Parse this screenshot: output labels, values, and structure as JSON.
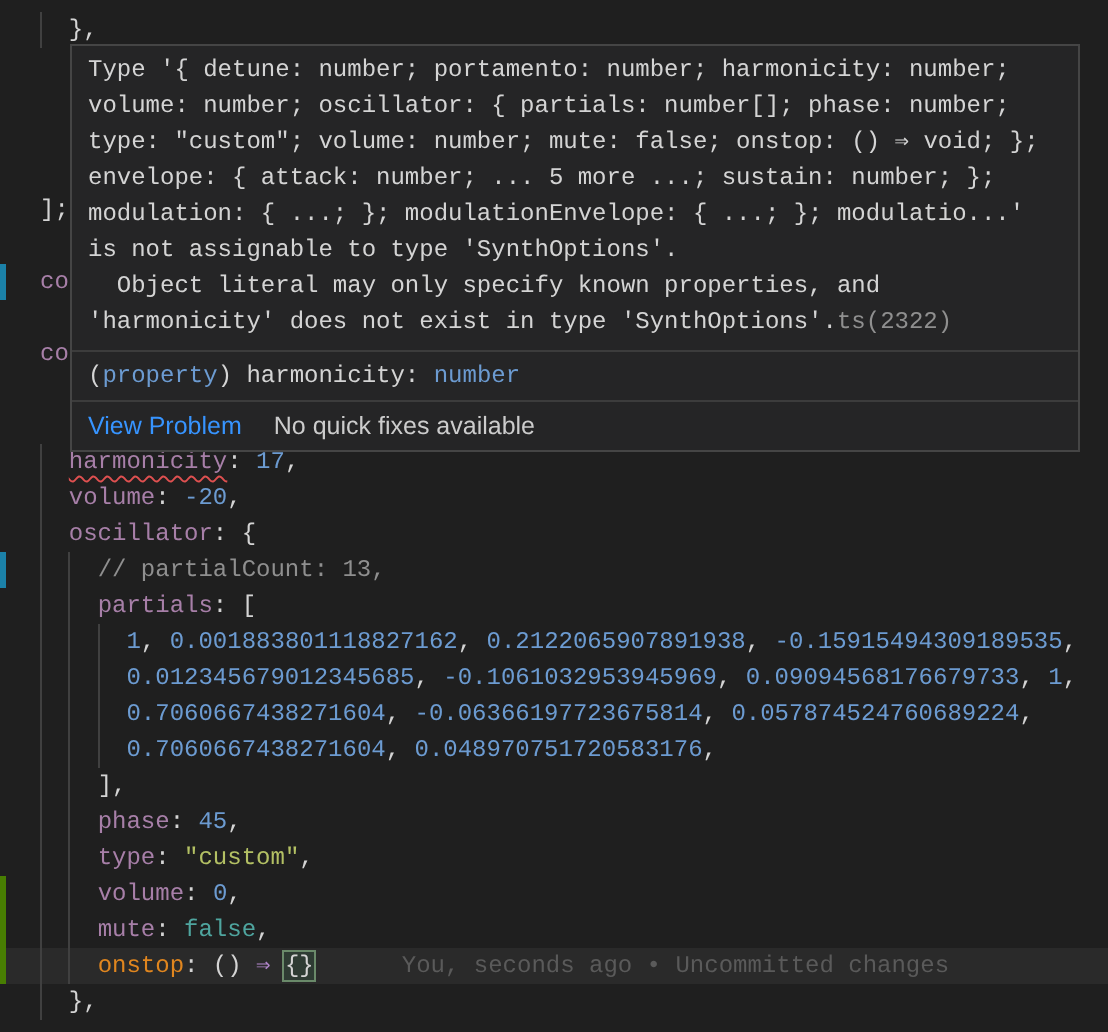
{
  "editor": {
    "top_lines": [
      {
        "tokens": [
          {
            "t": "  },",
            "kind": "punct"
          }
        ]
      }
    ],
    "behind_hover_lines": [
      {
        "tokens": [
          {
            "t": "];",
            "kind": "punct"
          }
        ]
      },
      {
        "modified": true,
        "tokens": [
          {
            "t": "co",
            "kind": "keyword"
          }
        ]
      },
      {
        "tokens": [
          {
            "t": "co",
            "kind": "keyword"
          }
        ]
      }
    ],
    "lines": [
      {
        "tokens": [
          {
            "t": "  harmonicity",
            "kind": "key",
            "error": true
          },
          {
            "t": ": ",
            "kind": "punct"
          },
          {
            "t": "17",
            "kind": "num"
          },
          {
            "t": ",",
            "kind": "punct"
          }
        ]
      },
      {
        "tokens": [
          {
            "t": "  volume",
            "kind": "key"
          },
          {
            "t": ": ",
            "kind": "punct"
          },
          {
            "t": "-20",
            "kind": "num"
          },
          {
            "t": ",",
            "kind": "punct"
          }
        ]
      },
      {
        "tokens": [
          {
            "t": "  oscillator",
            "kind": "key"
          },
          {
            "t": ": {",
            "kind": "punct"
          }
        ]
      },
      {
        "modified": true,
        "tokens": [
          {
            "t": "    // partialCount: 13,",
            "kind": "comment"
          }
        ]
      },
      {
        "tokens": [
          {
            "t": "    partials",
            "kind": "key"
          },
          {
            "t": ": [",
            "kind": "punct"
          }
        ]
      },
      {
        "tokens": [
          {
            "t": "      1",
            "kind": "num"
          },
          {
            "t": ", ",
            "kind": "punct"
          },
          {
            "t": "0.001883801118827162",
            "kind": "num"
          },
          {
            "t": ", ",
            "kind": "punct"
          },
          {
            "t": "0.2122065907891938",
            "kind": "num"
          },
          {
            "t": ", ",
            "kind": "punct"
          },
          {
            "t": "-0.15915494309189535",
            "kind": "num"
          },
          {
            "t": ",",
            "kind": "punct"
          }
        ]
      },
      {
        "tokens": [
          {
            "t": "      0.012345679012345685",
            "kind": "num"
          },
          {
            "t": ", ",
            "kind": "punct"
          },
          {
            "t": "-0.1061032953945969",
            "kind": "num"
          },
          {
            "t": ", ",
            "kind": "punct"
          },
          {
            "t": "0.09094568176679733",
            "kind": "num"
          },
          {
            "t": ", ",
            "kind": "punct"
          },
          {
            "t": "1",
            "kind": "num"
          },
          {
            "t": ",",
            "kind": "punct"
          }
        ]
      },
      {
        "tokens": [
          {
            "t": "      0.7060667438271604",
            "kind": "num"
          },
          {
            "t": ", ",
            "kind": "punct"
          },
          {
            "t": "-0.06366197723675814",
            "kind": "num"
          },
          {
            "t": ", ",
            "kind": "punct"
          },
          {
            "t": "0.057874524760689224",
            "kind": "num"
          },
          {
            "t": ",",
            "kind": "punct"
          }
        ]
      },
      {
        "tokens": [
          {
            "t": "      0.7060667438271604",
            "kind": "num"
          },
          {
            "t": ", ",
            "kind": "punct"
          },
          {
            "t": "0.048970751720583176",
            "kind": "num"
          },
          {
            "t": ",",
            "kind": "punct"
          }
        ]
      },
      {
        "tokens": [
          {
            "t": "    ],",
            "kind": "punct"
          }
        ]
      },
      {
        "tokens": [
          {
            "t": "    phase",
            "kind": "key"
          },
          {
            "t": ": ",
            "kind": "punct"
          },
          {
            "t": "45",
            "kind": "num"
          },
          {
            "t": ",",
            "kind": "punct"
          }
        ]
      },
      {
        "tokens": [
          {
            "t": "    type",
            "kind": "key"
          },
          {
            "t": ": ",
            "kind": "punct"
          },
          {
            "t": "\"custom\"",
            "kind": "str"
          },
          {
            "t": ",",
            "kind": "punct"
          }
        ]
      },
      {
        "added": true,
        "tokens": [
          {
            "t": "    volume",
            "kind": "key"
          },
          {
            "t": ": ",
            "kind": "punct"
          },
          {
            "t": "0",
            "kind": "num"
          },
          {
            "t": ",",
            "kind": "punct"
          }
        ]
      },
      {
        "added": true,
        "tokens": [
          {
            "t": "    mute",
            "kind": "key"
          },
          {
            "t": ": ",
            "kind": "punct"
          },
          {
            "t": "false",
            "kind": "bool"
          },
          {
            "t": ",",
            "kind": "punct"
          }
        ]
      },
      {
        "added": true,
        "current": true,
        "blame": "You, seconds ago • Uncommitted changes",
        "tokens": [
          {
            "t": "    onstop",
            "kind": "fn"
          },
          {
            "t": ": () ",
            "kind": "punct"
          },
          {
            "t": "⇒",
            "kind": "arrow"
          },
          {
            "t": " {}",
            "kind": "bracket"
          }
        ]
      },
      {
        "tokens": [
          {
            "t": "  },",
            "kind": "punct"
          }
        ]
      }
    ]
  },
  "hover": {
    "message": [
      "Type '{ detune: number; portamento: number; harmonicity: number;",
      "volume: number; oscillator: { partials: number[]; phase: number;",
      "type: \"custom\"; volume: number; mute: false; onstop: () ⇒ void; };",
      "envelope: { attack: number; ... 5 more ...; sustain: number; };",
      "modulation: { ...; }; modulationEnvelope: { ...; }; modulatio...'",
      "is not assignable to type 'SynthOptions'.",
      "  Object literal may only specify known properties, and",
      "'harmonicity' does not exist in type 'SynthOptions'."
    ],
    "code": "ts(2322)",
    "signature": [
      {
        "t": "(",
        "kind": "punct"
      },
      {
        "t": "property",
        "kind": "type"
      },
      {
        "t": ") harmonicity: ",
        "kind": "punct"
      },
      {
        "t": "number",
        "kind": "type"
      }
    ],
    "link": "View Problem",
    "note": "No quick fixes available"
  }
}
